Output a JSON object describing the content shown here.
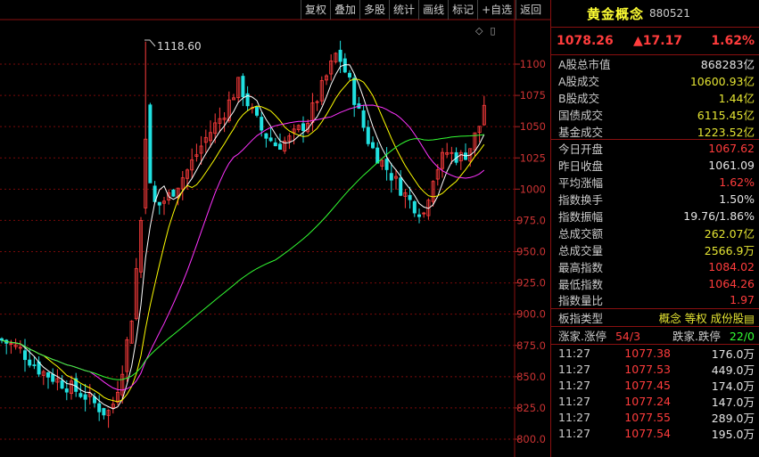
{
  "toolbar": {
    "buttons": [
      "复权",
      "叠加",
      "多股",
      "统计",
      "画线",
      "标记",
      "+自选",
      "返回"
    ]
  },
  "chart_icons": {
    "diamond": "◇",
    "box": "▯"
  },
  "chart_data": {
    "type": "candlestick",
    "yticks": [
      "1100",
      "1075",
      "1050",
      "1025",
      "1000",
      "975.0",
      "950.0",
      "925.0",
      "900.0",
      "875.0",
      "850.0",
      "825.0",
      "800.0"
    ],
    "ylim": [
      800,
      1100
    ],
    "high_annotation": "1118.60",
    "up_color": "#ff3c3c",
    "down_color": "#20e0e0",
    "ma_colors": [
      "#ffffff",
      "#ffff00",
      "#ff33ff",
      "#33ff33"
    ]
  },
  "panel": {
    "name": "黄金概念",
    "code": "880521",
    "price": "1078.26",
    "change": "▲17.17",
    "pct": "1.62%",
    "stats": [
      {
        "label": "A股总市值",
        "value": "868283亿",
        "color": "#e5e5e5"
      },
      {
        "label": "A股成交",
        "value": "10600.93亿",
        "color": "#e5e533"
      },
      {
        "label": "B股成交",
        "value": "1.44亿",
        "color": "#e5e533"
      },
      {
        "label": "国债成交",
        "value": "6115.45亿",
        "color": "#e5e533"
      },
      {
        "label": "基金成交",
        "value": "1223.52亿",
        "color": "#e5e533"
      },
      {
        "label": "今日开盘",
        "value": "1067.62",
        "color": "#ff3c3c"
      },
      {
        "label": "昨日收盘",
        "value": "1061.09",
        "color": "#e5e5e5"
      },
      {
        "label": "平均涨幅",
        "value": "1.62%",
        "color": "#ff3c3c"
      },
      {
        "label": "指数换手",
        "value": "1.50%",
        "color": "#e5e5e5"
      },
      {
        "label": "指数振幅",
        "value": "19.76/1.86%",
        "color": "#e5e5e5"
      },
      {
        "label": "总成交额",
        "value": "262.07亿",
        "color": "#e5e533"
      },
      {
        "label": "总成交量",
        "value": "2566.9万",
        "color": "#e5e533"
      },
      {
        "label": "最高指数",
        "value": "1084.02",
        "color": "#ff3c3c"
      },
      {
        "label": "最低指数",
        "value": "1064.26",
        "color": "#ff3c3c"
      },
      {
        "label": "指数量比",
        "value": "1.97",
        "color": "#ff3c3c"
      }
    ],
    "sector_type_label": "板指类型",
    "sector_type_value": "概念 等权 成份股▤",
    "breadth": {
      "up_label": "涨家.涨停",
      "up_value": "54/3",
      "down_label": "跌家.跌停",
      "down_value": "22/0"
    },
    "trades": [
      {
        "time": "11:27",
        "price": "1077.38",
        "vol": "176.0万"
      },
      {
        "time": "11:27",
        "price": "1077.53",
        "vol": "449.0万"
      },
      {
        "time": "11:27",
        "price": "1077.45",
        "vol": "174.0万"
      },
      {
        "time": "11:27",
        "price": "1077.24",
        "vol": "147.0万"
      },
      {
        "time": "11:27",
        "price": "1077.55",
        "vol": "289.0万"
      },
      {
        "time": "11:27",
        "price": "1077.54",
        "vol": "195.0万"
      }
    ]
  }
}
